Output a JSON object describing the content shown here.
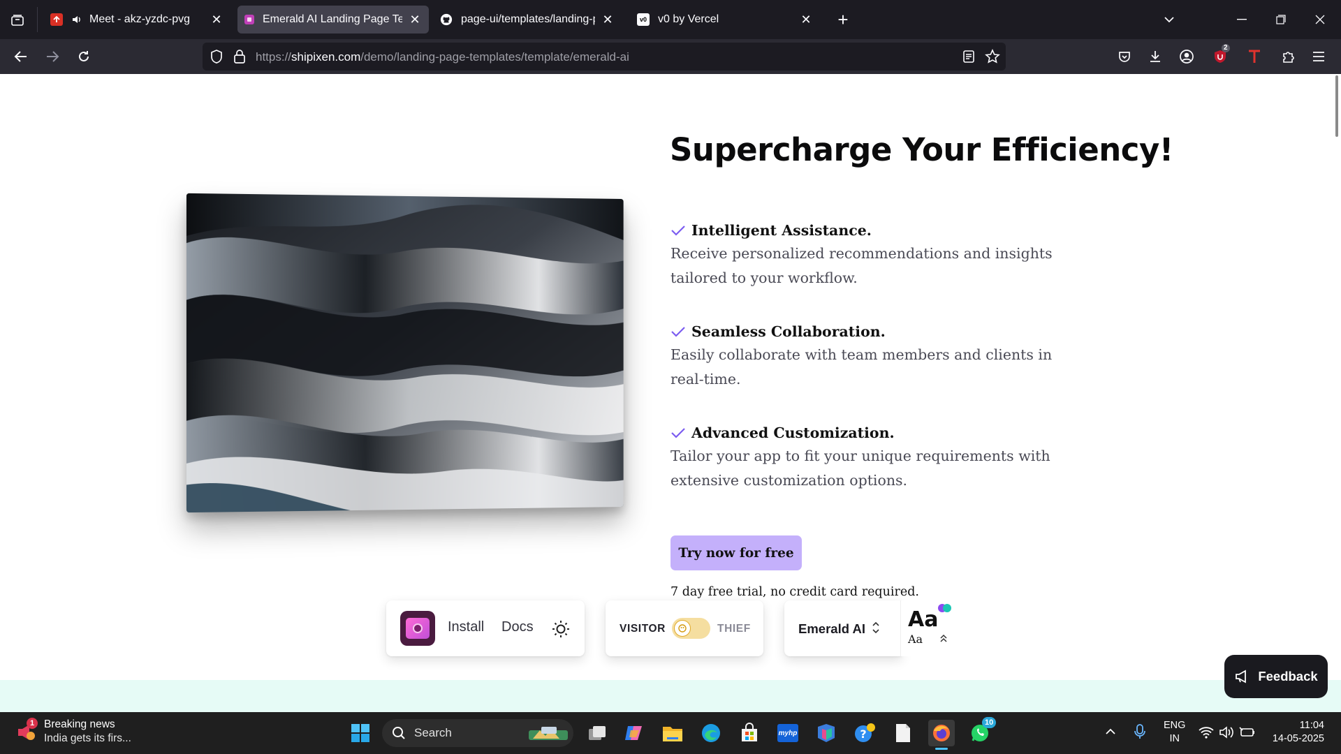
{
  "browser": {
    "tabs": [
      {
        "title": "Meet - akz-yzdc-pvg",
        "active": false
      },
      {
        "title": "Emerald AI Landing Page Templ",
        "active": true
      },
      {
        "title": "page-ui/templates/landing-pag",
        "active": false
      },
      {
        "title": "v0 by Vercel",
        "active": false
      }
    ],
    "url": {
      "scheme": "https://",
      "host": "shipixen.com",
      "path": "/demo/landing-page-templates/template/emerald-ai"
    },
    "extension_badge": "2"
  },
  "page": {
    "headline": "Supercharge Your Efficiency!",
    "features": [
      {
        "title": "Intelligent Assistance.",
        "description": "Receive personalized recommendations and insights tailored to your workflow."
      },
      {
        "title": "Seamless Collaboration.",
        "description": "Easily collaborate with team members and clients in real-time."
      },
      {
        "title": "Advanced Customization.",
        "description": "Tailor your app to fit your unique requirements with extensive customization options."
      }
    ],
    "cta_label": "Try now for free",
    "trial_note": "7 day free trial, no credit card required.",
    "toolbar": {
      "install_label": "Install",
      "docs_label": "Docs",
      "visitor_label": "VISITOR",
      "thief_label": "THIEF",
      "theme_name": "Emerald AI",
      "font_sample_large": "Aa",
      "font_sample_small": "Aa"
    },
    "feedback_label": "Feedback",
    "colors": {
      "accent": "#c4b0fb",
      "check": "#7b5cf0",
      "mint": "#e6fbf6"
    }
  },
  "taskbar": {
    "news_title": "Breaking news",
    "news_subtitle": "India gets its firs...",
    "news_badge": "1",
    "search_placeholder": "Search",
    "whatsapp_badge": "10",
    "language": "ENG",
    "region": "IN",
    "time": "11:04",
    "date": "14-05-2025"
  }
}
